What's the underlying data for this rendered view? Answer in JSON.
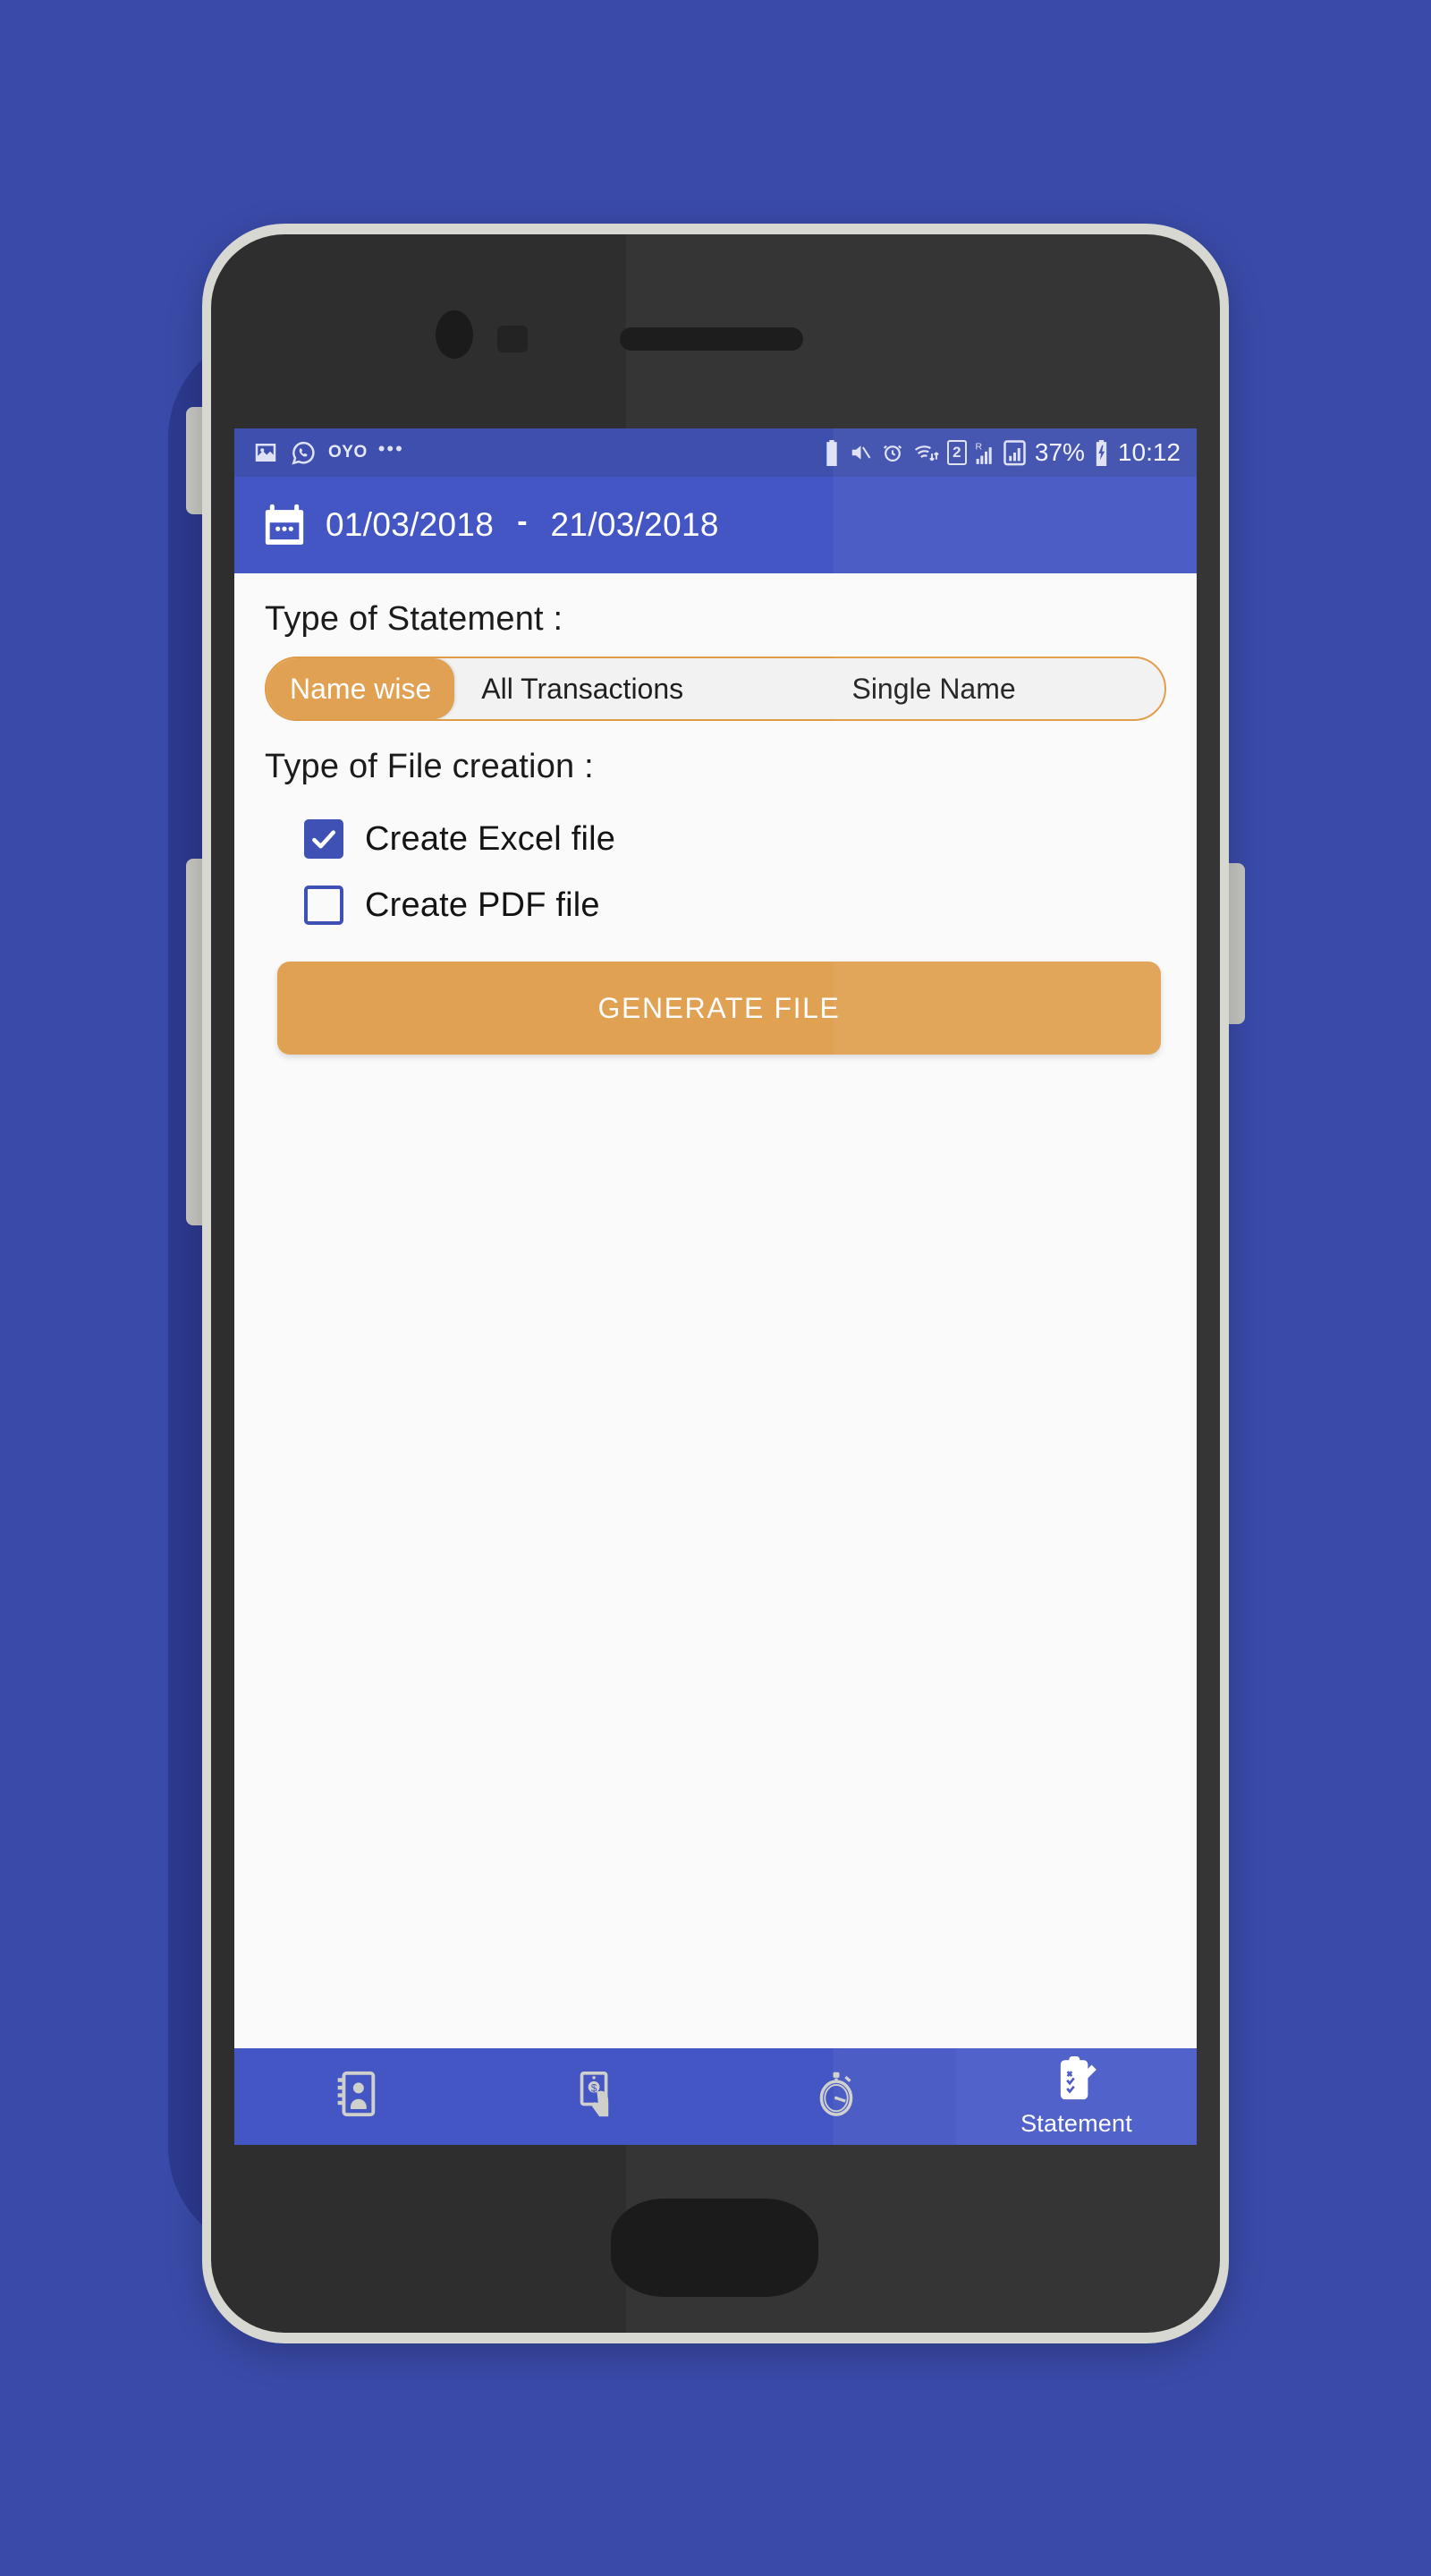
{
  "backdrop_color": "#3a4aa8",
  "theme": {
    "primary": "#4456c4",
    "status_bar": "#3e4fae",
    "accent": "#e0a252",
    "accent_border": "#e09a45",
    "checkbox": "#3f51b5",
    "content_bg": "#fafafa",
    "text": "#141414",
    "on_primary": "#ffffff"
  },
  "status_bar": {
    "left_icons": [
      {
        "name": "image-icon",
        "glyph": "image"
      },
      {
        "name": "whatsapp-icon",
        "glyph": "whatsapp"
      }
    ],
    "oyo_label": "OYO",
    "overflow_dots": "•••",
    "right_icons": [
      {
        "name": "battery-saver-icon"
      },
      {
        "name": "volume-mute-icon"
      },
      {
        "name": "alarm-icon"
      },
      {
        "name": "wifi-transfer-icon"
      },
      {
        "name": "sim-2-icon",
        "label": "2"
      },
      {
        "name": "signal-roaming-icon",
        "label": "R"
      },
      {
        "name": "signal-bars-icon"
      }
    ],
    "battery_percent": "37%",
    "charging_icon": "battery-charging-icon",
    "clock": "10:12"
  },
  "appbar": {
    "calendar_icon": "calendar-icon",
    "date_from": "01/03/2018",
    "separator": "-",
    "date_to": "21/03/2018"
  },
  "main": {
    "statement_section": {
      "label": "Type of Statement :",
      "options": [
        {
          "label": "Name wise",
          "selected": true
        },
        {
          "label": "All Transactions",
          "selected": false
        },
        {
          "label": "Single Name",
          "selected": false
        }
      ]
    },
    "file_section": {
      "label": "Type of File creation :",
      "checkboxes": [
        {
          "label": "Create Excel file",
          "checked": true
        },
        {
          "label": "Create PDF file",
          "checked": false
        }
      ]
    },
    "generate_button": "GENERATE FILE"
  },
  "bottom_nav": [
    {
      "icon": "address-book-icon",
      "label": "",
      "active": false
    },
    {
      "icon": "hand-holding-money-icon",
      "label": "",
      "active": false
    },
    {
      "icon": "stopwatch-icon",
      "label": "",
      "active": false
    },
    {
      "icon": "clipboard-pen-icon",
      "label": "Statement",
      "active": true
    }
  ]
}
